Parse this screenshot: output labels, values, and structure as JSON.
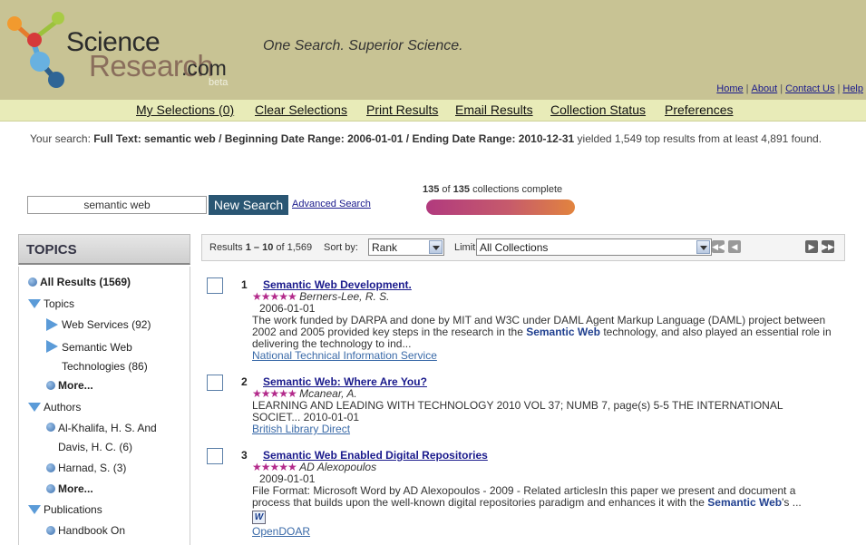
{
  "header": {
    "logo_science": "Science",
    "logo_research": "Research",
    "logo_com": ".com",
    "logo_beta": "beta",
    "tagline": "One Search. Superior Science.",
    "links": [
      "Home",
      "About",
      "Contact Us",
      "Help"
    ]
  },
  "nav": [
    "My Selections (0)",
    "Clear Selections",
    "Print Results",
    "Email Results",
    "Collection Status",
    "Preferences"
  ],
  "summary": {
    "prefix": "Your search: ",
    "query": "Full Text: semantic web / Beginning Date Range: 2006-01-01 / Ending Date Range: 2010-12-31",
    "suffix": " yielded 1,549 top results from at least 4,891 found."
  },
  "search": {
    "value": "semantic web",
    "button": "New Search",
    "advanced": "Advanced Search"
  },
  "collections": {
    "done": "135",
    "of": " of ",
    "total": "135",
    "suffix": " collections complete",
    "progress": 1.0
  },
  "topics": {
    "title": "TOPICS",
    "items": [
      {
        "text": "All Results (1569)",
        "icon": "circle",
        "bold": true,
        "indent": 0
      },
      {
        "text": "Topics",
        "icon": "down",
        "bold": false,
        "indent": 0
      },
      {
        "text": "Web Services (92)",
        "icon": "right",
        "bold": false,
        "indent": 1
      },
      {
        "text": "Semantic Web\nTechnologies (86)",
        "icon": "right",
        "bold": false,
        "indent": 1
      },
      {
        "text": "More...",
        "icon": "circle",
        "bold": true,
        "indent": 1
      },
      {
        "text": "Authors",
        "icon": "down",
        "bold": false,
        "indent": 0
      },
      {
        "text": "Al-Khalifa, H. S. And\nDavis, H. C. (6)",
        "icon": "circle",
        "bold": false,
        "indent": 1
      },
      {
        "text": "Harnad, S. (3)",
        "icon": "circle",
        "bold": false,
        "indent": 1
      },
      {
        "text": "More...",
        "icon": "circle",
        "bold": true,
        "indent": 1
      },
      {
        "text": "Publications",
        "icon": "down",
        "bold": false,
        "indent": 0
      },
      {
        "text": "Handbook On",
        "icon": "circle",
        "bold": false,
        "indent": 1
      }
    ]
  },
  "toolbar": {
    "results_prefix": "Results ",
    "results_range": "1 – 10",
    "results_of": " of 1,569",
    "sort_label": "Sort by:",
    "sort_value": "Rank",
    "limit_label": "Limit to:",
    "limit_value": "All Collections",
    "pager": [
      "first-page-icon",
      "prev-page-icon",
      "next-page-icon",
      "last-page-icon"
    ]
  },
  "results": [
    {
      "num": "1",
      "title": "Semantic Web Development.",
      "stars": "★★★★★",
      "author": "Berners-Lee, R. S.",
      "date": "2006-01-01",
      "desc_before": "The work funded by DARPA and done by MIT and W3C under DAML Agent Markup Language (DAML) project between 2002 and 2005 provided key steps in the research in the ",
      "desc_bold": "Semantic Web",
      "desc_after": " technology, and also played an essential role in delivering the technology to ind...",
      "source": "National Technical Information Service"
    },
    {
      "num": "2",
      "title": "Semantic Web: Where Are You?",
      "stars": "★★★★★",
      "author": "Mcanear, A.",
      "date": "LEARNING AND LEADING WITH TECHNOLOGY  2010  VOL 37; NUMB 7,  page(s) 5-5  THE INTERNATIONAL SOCIET...   2010-01-01",
      "source": "British Library Direct"
    },
    {
      "num": "3",
      "title": "Semantic Web Enabled Digital Repositories",
      "stars": "★★★★★",
      "author": "AD Alexopoulos",
      "date": "2009-01-01",
      "desc_before": "File Format: Microsoft Word by AD Alexopoulos - 2009 - Related articlesIn this paper we present and document a process that builds upon the well-known digital repositories paradigm and enhances it with the ",
      "desc_bold": "Semantic Web",
      "desc_after": "'s ...",
      "file_icon": "W",
      "source": "OpenDOAR"
    }
  ]
}
